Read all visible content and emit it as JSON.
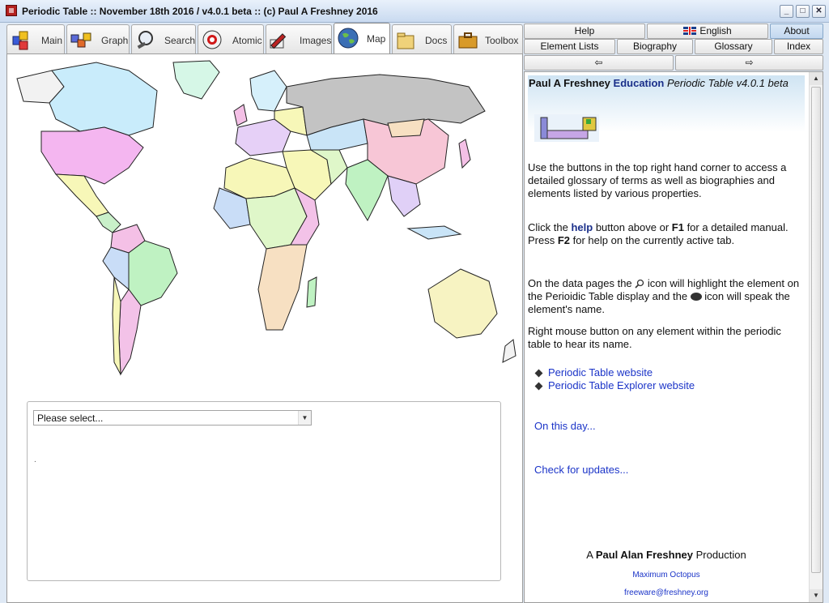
{
  "window": {
    "title": "Periodic Table :: November 18th 2016 / v4.0.1 beta :: (c) Paul A Freshney 2016",
    "minimize": "_",
    "maximize": "□",
    "close": "✕"
  },
  "left_tabs": [
    {
      "label": "Main",
      "icon": "blocks-icon"
    },
    {
      "label": "Graph",
      "icon": "graph-icon"
    },
    {
      "label": "Search",
      "icon": "magnifier-icon"
    },
    {
      "label": "Atomic",
      "icon": "atom-icon"
    },
    {
      "label": "Images",
      "icon": "pen-icon"
    },
    {
      "label": "Map",
      "icon": "globe-icon",
      "active": true
    },
    {
      "label": "Docs",
      "icon": "folder-icon"
    },
    {
      "label": "Toolbox",
      "icon": "toolbox-icon"
    }
  ],
  "right_buttons": {
    "help": "Help",
    "english": "English",
    "about": "About",
    "element_lists": "Element Lists",
    "biography": "Biography",
    "glossary": "Glossary",
    "index": "Index",
    "back": "⇦",
    "forward": "⇨"
  },
  "map_panel": {
    "dropdown_value": "Please select...",
    "dot": "."
  },
  "about": {
    "header_name": "Paul A Freshney",
    "header_edu": "Education",
    "header_product": "Periodic Table v4.0.1 beta",
    "para1": "Use the buttons in the top right hand corner to access a detailed glossary of terms as well as biographies and elements listed by various properties.",
    "para2_a": "Click the ",
    "para2_help": "help",
    "para2_b": " button above or ",
    "para2_f1": "F1",
    "para2_c": " for a detailed manual. Press ",
    "para2_f2": "F2",
    "para2_d": " for help on the currently active tab.",
    "para3_a": "On the data pages the ",
    "para3_b": " icon will highlight the element on the Perioidic Table display and the ",
    "para3_c": " icon will speak the element's name.",
    "para4": "Right mouse button on any element within the periodic table to hear its name.",
    "link1": "Periodic Table website",
    "link2": "Periodic Table Explorer website",
    "on_this_day": "On this day...",
    "check_updates": "Check for updates...",
    "credit_a": "A ",
    "credit_name": "Paul Alan Freshney",
    "credit_b": " Production",
    "maximum_octopus": "Maximum Octopus",
    "email": "freeware@freshney.org"
  },
  "colors": {
    "link_blue": "#1b34c8",
    "heading_blue": "#1a2f8a",
    "titlebar": "#c9daf0"
  }
}
